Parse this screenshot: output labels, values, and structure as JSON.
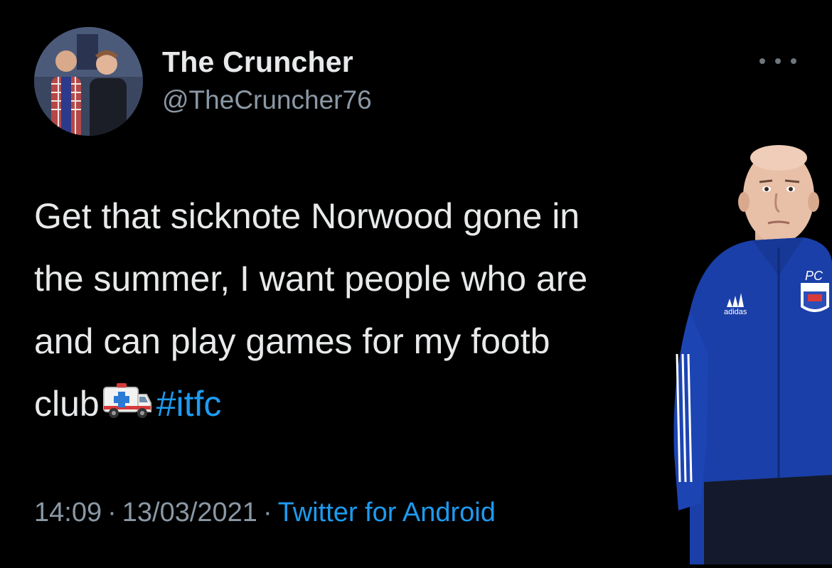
{
  "author": {
    "display_name": "The Cruncher",
    "handle": "@TheCruncher76",
    "avatar_icon": "profile-photo"
  },
  "menu": {
    "icon": "more-horizontal-icon"
  },
  "tweet": {
    "lines": [
      "Get that sicknote Norwood gone in",
      "the summer, I want people who are",
      "and can play games for my footb",
      "club"
    ],
    "emoji": "🚑",
    "hashtag": "#itfc"
  },
  "meta": {
    "time": "14:09",
    "separator": "·",
    "date": "13/03/2021",
    "source": "Twitter for Android"
  },
  "overlay": {
    "description_icon": "person-photo-cutout",
    "badge_text": "PC",
    "brand_text": "adidas"
  },
  "colors": {
    "background": "#000000",
    "text_primary": "#e7e9ea",
    "text_secondary": "#8b98a5",
    "link": "#1d9bf0",
    "jacket": "#1a3fa8"
  }
}
